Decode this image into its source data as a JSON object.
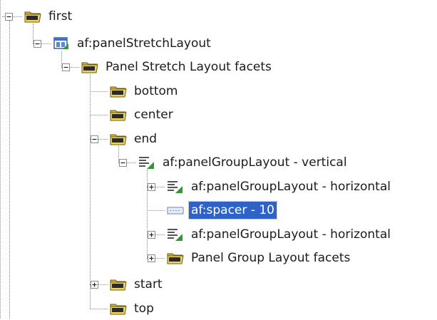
{
  "tree": {
    "nodes": [
      {
        "id": "first",
        "label": "first",
        "icon": "folder-icon",
        "expander": "minus",
        "selected": false
      },
      {
        "id": "af-panelstretchlayout",
        "label": "af:panelStretchLayout",
        "icon": "panel-stretch-layout-icon",
        "expander": "minus",
        "selected": false
      },
      {
        "id": "panel-stretch-layout-facets",
        "label": "Panel Stretch Layout facets",
        "icon": "folder-icon",
        "expander": "minus",
        "selected": false
      },
      {
        "id": "bottom",
        "label": "bottom",
        "icon": "folder-icon",
        "expander": "none",
        "selected": false
      },
      {
        "id": "center",
        "label": "center",
        "icon": "folder-icon",
        "expander": "none",
        "selected": false
      },
      {
        "id": "end",
        "label": "end",
        "icon": "folder-icon",
        "expander": "minus",
        "selected": false
      },
      {
        "id": "af-panelgrouplayout-vertical",
        "label": "af:panelGroupLayout - vertical",
        "icon": "panel-group-layout-icon",
        "expander": "minus",
        "selected": false
      },
      {
        "id": "af-panelgrouplayout-horizontal-1",
        "label": "af:panelGroupLayout - horizontal",
        "icon": "panel-group-layout-icon",
        "expander": "plus",
        "selected": false
      },
      {
        "id": "af-spacer-10",
        "label": "af:spacer - 10",
        "icon": "spacer-icon",
        "expander": "none",
        "selected": true
      },
      {
        "id": "af-panelgrouplayout-horizontal-2",
        "label": "af:panelGroupLayout - horizontal",
        "icon": "panel-group-layout-icon",
        "expander": "plus",
        "selected": false
      },
      {
        "id": "panel-group-layout-facets",
        "label": "Panel Group Layout facets",
        "icon": "folder-icon",
        "expander": "plus",
        "selected": false
      },
      {
        "id": "start",
        "label": "start",
        "icon": "folder-icon",
        "expander": "plus",
        "selected": false
      },
      {
        "id": "top",
        "label": "top",
        "icon": "folder-icon",
        "expander": "none",
        "selected": false
      }
    ]
  }
}
